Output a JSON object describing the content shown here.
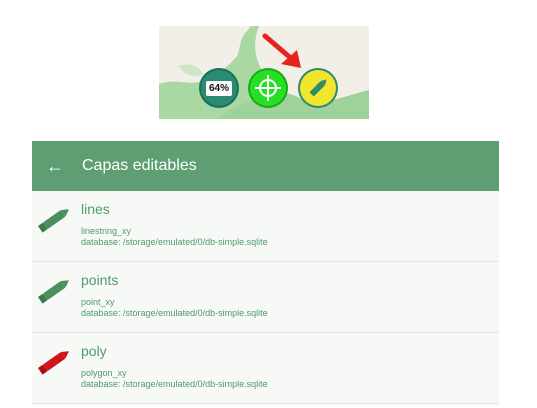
{
  "map_controls": {
    "zoom_badge": "64%",
    "gps_icon": "crosshair-icon",
    "edit_icon": "pencil-icon",
    "arrow_color": "#e8231c"
  },
  "panel": {
    "title": "Capas editables",
    "back_icon": "arrow-left-icon",
    "items": [
      {
        "name": "lines",
        "type": "linestring_xy",
        "database": "database: /storage/emulated/0/db-simple.sqlite",
        "color": "#4a8f5c"
      },
      {
        "name": "points",
        "type": "point_xy",
        "database": "database: /storage/emulated/0/db-simple.sqlite",
        "color": "#4a8f5c"
      },
      {
        "name": "poly",
        "type": "polygon_xy",
        "database": "database: /storage/emulated/0/db-simple.sqlite",
        "color": "#d0151b"
      }
    ]
  },
  "colors": {
    "appbar": "#5d9f73",
    "text_green": "#4f9a6b",
    "gps": "#26e026",
    "edit": "#f2e52d"
  }
}
